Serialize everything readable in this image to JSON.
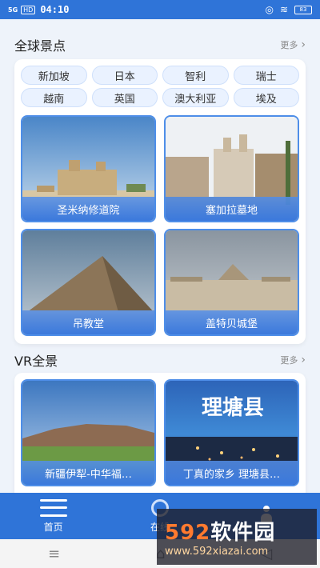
{
  "status": {
    "signal": "5G",
    "hd": "HD",
    "time": "04:10",
    "battery": "83"
  },
  "global": {
    "title": "全球景点",
    "more": "更多",
    "tags": [
      "新加坡",
      "日本",
      "智利",
      "瑞士",
      "越南",
      "英国",
      "澳大利亚",
      "埃及"
    ],
    "tiles": [
      {
        "label": "圣米纳修道院"
      },
      {
        "label": "塞加拉墓地"
      },
      {
        "label": "吊教堂"
      },
      {
        "label": "盖特贝城堡"
      }
    ]
  },
  "vr": {
    "title": "VR全景",
    "more": "更多",
    "tiles": [
      {
        "label": "新疆伊犁-中华福…"
      },
      {
        "label": "丁真的家乡 理塘县…",
        "overlay_text": "理塘县"
      }
    ]
  },
  "nav": [
    {
      "label": "首页",
      "icon": "home-menu-icon"
    },
    {
      "label": "在线",
      "icon": "location-pin-icon"
    },
    {
      "label": "",
      "icon": "profile-icon"
    }
  ],
  "watermark": {
    "brand_num": "592",
    "brand_text": "软件园",
    "url": "www.592xiazai.com"
  },
  "colors": {
    "primary": "#2f74d8",
    "tag_bg": "#eaf2ff",
    "page_bg": "#eef3fa"
  }
}
